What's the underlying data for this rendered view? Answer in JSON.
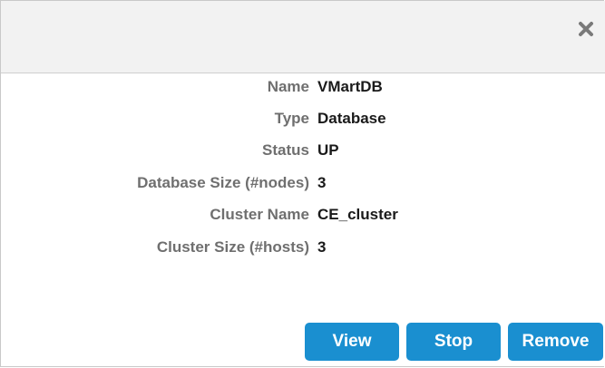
{
  "dialog": {
    "close_icon": "close-x-icon",
    "details": [
      {
        "label": "Name",
        "value": "VMartDB"
      },
      {
        "label": "Type",
        "value": "Database"
      },
      {
        "label": "Status",
        "value": "UP"
      },
      {
        "label": "Database Size (#nodes)",
        "value": "3"
      },
      {
        "label": "Cluster Name",
        "value": "CE_cluster"
      },
      {
        "label": "Cluster Size (#hosts)",
        "value": "3"
      }
    ],
    "buttons": {
      "view": "View",
      "stop": "Stop",
      "remove": "Remove"
    }
  },
  "colors": {
    "header_bg": "#f2f2f2",
    "label_text": "#6f6f6f",
    "value_text": "#1a1a1a",
    "button_bg": "#1a8fd0",
    "button_text": "#ffffff",
    "close_icon": "#7a7a7a"
  }
}
